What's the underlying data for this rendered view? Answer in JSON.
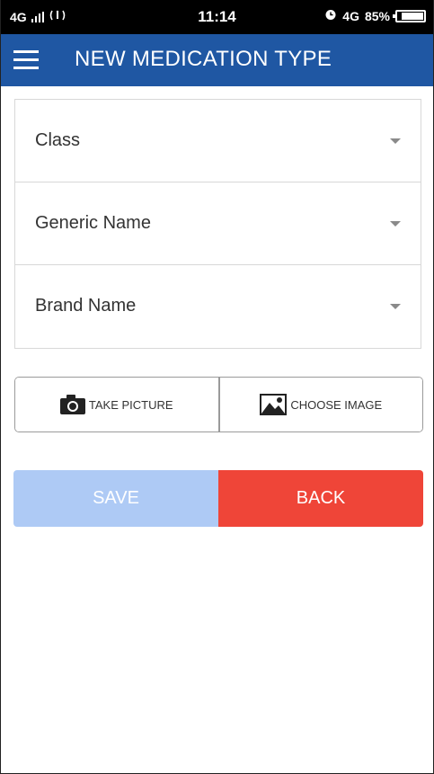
{
  "status_bar": {
    "network": "4G",
    "signal_icon": "signal-bars-icon",
    "hotspot_icon": "wireless-icon",
    "time": "11:14",
    "alarm_icon": "alarm-icon",
    "data_type": "4G",
    "battery_percent": "85%",
    "battery_level": 0.85
  },
  "app_bar": {
    "menu_icon": "hamburger-menu-icon",
    "title": "NEW MEDICATION TYPE",
    "background_color": "#1f57a3"
  },
  "form": {
    "fields": [
      {
        "label": "Class",
        "icon": "dropdown-caret-icon"
      },
      {
        "label": "Generic Name",
        "icon": "dropdown-caret-icon"
      },
      {
        "label": "Brand Name",
        "icon": "dropdown-caret-icon"
      }
    ]
  },
  "image_actions": {
    "take_picture_label": "TAKE PICTURE",
    "take_picture_icon": "camera-icon",
    "choose_image_label": "CHOOSE IMAGE",
    "choose_image_icon": "image-icon"
  },
  "actions": {
    "save_label": "SAVE",
    "save_color": "#aecaf5",
    "back_label": "BACK",
    "back_color": "#ef4538"
  }
}
